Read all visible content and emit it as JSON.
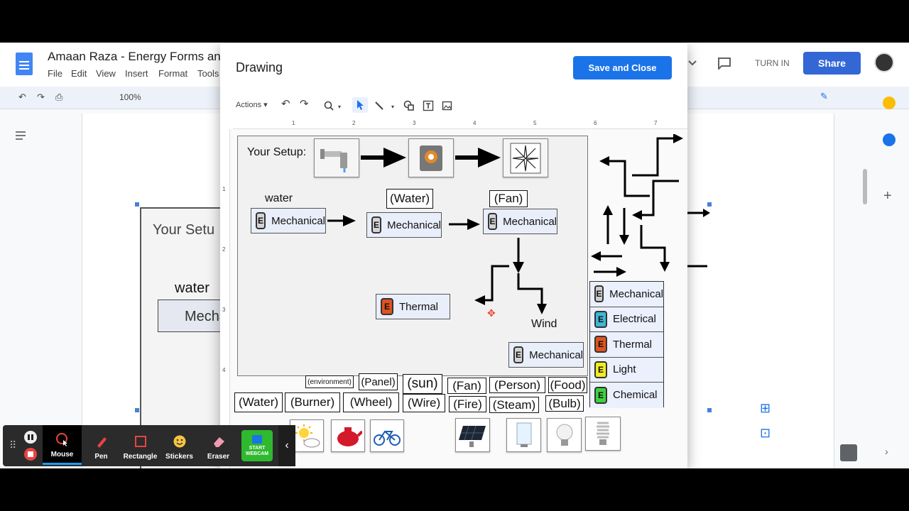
{
  "docs": {
    "title": "Amaan Raza - Energy Forms and",
    "menu": [
      "File",
      "Edit",
      "View",
      "Insert",
      "Format",
      "Tools"
    ],
    "zoom": "100%",
    "turn_in": "TURN IN",
    "share": "Share",
    "bg_setup_label": "Your Setu",
    "bg_water_label": "water",
    "bg_mecha_label": "Mecha"
  },
  "dialog": {
    "title": "Drawing",
    "save_close": "Save and Close",
    "actions": "Actions",
    "ruler_h": [
      "1",
      "2",
      "3",
      "4",
      "5",
      "6",
      "7"
    ],
    "ruler_v": [
      "1",
      "2",
      "3",
      "4"
    ]
  },
  "canvas": {
    "setup_label": "Your Setup:",
    "water_label": "water",
    "water_paren": "(Water)",
    "fan_paren": "(Fan)",
    "wind_label": "Wind",
    "card1": "Mechanical",
    "card2": "Mechanical",
    "card3": "Mechanical",
    "card_thermal": "Thermal",
    "card_bottom": "Mechanical",
    "e_letter": "E"
  },
  "legend": [
    {
      "label": "Mechanical",
      "color": "#cfcfcf"
    },
    {
      "label": "Electrical",
      "color": "#3fb6d6"
    },
    {
      "label": "Thermal",
      "color": "#e0521f"
    },
    {
      "label": "Light",
      "color": "#f3ec23"
    },
    {
      "label": "Chemical",
      "color": "#3fd13f"
    }
  ],
  "words_row1": [
    "(environment)",
    "(Panel)",
    "(sun)",
    "(Fan)",
    "(Person)",
    "(Food)"
  ],
  "words_row2": [
    "(Water)",
    "(Burner)",
    "(Wheel)",
    "(Wire)",
    "(Fire)",
    "(Steam)",
    "(Bulb)"
  ],
  "recbar": {
    "mouse": "Mouse",
    "pen": "Pen",
    "rectangle": "Rectangle",
    "stickers": "Stickers",
    "eraser": "Eraser",
    "webcam": "START WEBCAM"
  }
}
